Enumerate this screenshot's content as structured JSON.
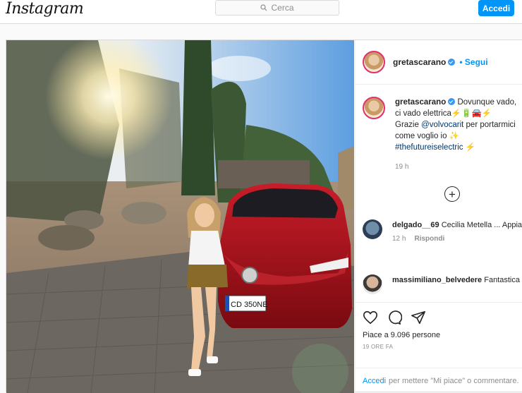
{
  "header": {
    "logo": "Instagram",
    "search_placeholder": "Cerca",
    "login_label": "Accedi"
  },
  "post": {
    "author": "gretascarano",
    "follow_label": "Segui",
    "caption": {
      "line1": "Dovunque vado, ci vado elettrica⚡️🔋🚘⚡️",
      "thanks": "Grazie",
      "mention": "@volvocarit",
      "rest": "per portarmici come voglio io ✨",
      "hashtag": "#thefutureiselectric",
      "hashtag_tail": "⚡️",
      "time": "19 h"
    },
    "comments": [
      {
        "user": "delgado__69",
        "text": "Cecilia Metella ... Appia antica 👏👏👏",
        "time": "12 h",
        "reply": "Rispondi"
      },
      {
        "user": "massimiliano_belvedere",
        "text": "Fantastica Fo e l'Appia Antica."
      }
    ],
    "likes": "Piace a 9.096 persone",
    "ago": "19 ORE FA",
    "login_prompt": {
      "link": "Accedi",
      "text": "per mettere \"Mi piace\" o commentare."
    },
    "plate": "CD 350NE"
  },
  "colors": {
    "accent": "#0095f6",
    "car": "#b0101a",
    "sky": "#6fa8e0"
  }
}
